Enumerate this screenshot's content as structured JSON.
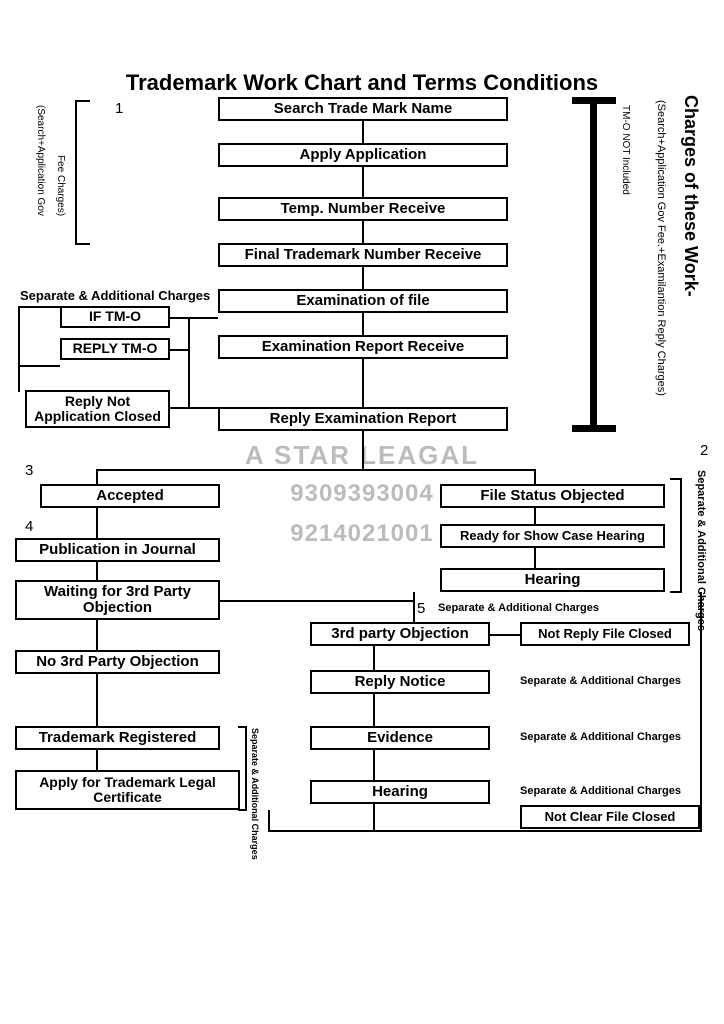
{
  "title": "Trademark Work Chart and Terms Conditions",
  "main": {
    "s1": "Search Trade Mark Name",
    "s2": "Apply Application",
    "s3": "Temp. Number Receive",
    "s4": "Final Trademark Number Receive",
    "s5": "Examination of file",
    "s6": "Examination Report Receive",
    "s7": "Reply Examination Report"
  },
  "tmo": {
    "if": "IF TM-O",
    "reply": "REPLY TM-O",
    "closed": "Reply Not Application Closed"
  },
  "left": {
    "accepted": "Accepted",
    "pub": "Publication in Journal",
    "wait": "Waiting for 3rd Party Objection",
    "no3p": "No 3rd Party Objection",
    "reg": "Trademark Registered",
    "cert": "Apply for Trademark Legal Certificate"
  },
  "right": {
    "obj": "File Status Objected",
    "ready": "Ready for Show Case Hearing",
    "hearing": "Hearing",
    "p3": "3rd party Objection",
    "notreply": "Not Reply File Closed",
    "notice": "Reply Notice",
    "evidence": "Evidence",
    "hearing2": "Hearing",
    "notclear": "Not Clear File Closed"
  },
  "numbers": {
    "n1": "1",
    "n2": "2",
    "n3": "3",
    "n4": "4",
    "n5": "5"
  },
  "labels": {
    "sep": "Separate & Additional Charges",
    "tmo_not": "TM-O NOT Included",
    "charges": "Charges of these Work-",
    "charges_sub": "(Search+Application Gov Fee.+Examilantion Reply Charges)",
    "left_side": "(Search+Application Gov",
    "fee": "Fee Charges)",
    "sep_v": "Separate & Additional Charges"
  },
  "watermark": {
    "w1": "A STAR LEAGAL",
    "w2": "9309393004",
    "w3": "9214021001"
  }
}
